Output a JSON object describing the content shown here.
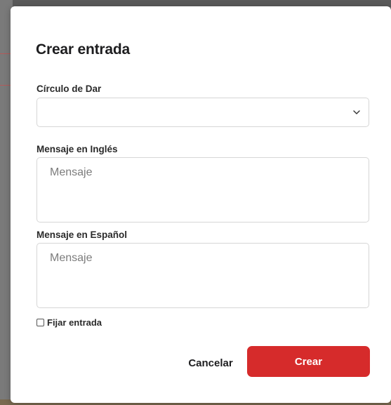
{
  "modal": {
    "title": "Crear entrada",
    "circle_field": {
      "label": "Círculo de Dar",
      "selected_value": ""
    },
    "message_en": {
      "label": "Mensaje en Inglés",
      "placeholder": "Mensaje"
    },
    "message_es": {
      "label": "Mensaje en Español",
      "placeholder": "Mensaje"
    },
    "pin_checkbox": {
      "label": "Fijar entrada",
      "checked": false
    },
    "buttons": {
      "cancel_label": "Cancelar",
      "create_label": "Crear"
    }
  },
  "colors": {
    "primary_button": "#d62b2b",
    "border": "#d6d6d6",
    "placeholder": "#7c7c7c"
  },
  "icons": {
    "select_arrow": "chevron-down-icon"
  }
}
